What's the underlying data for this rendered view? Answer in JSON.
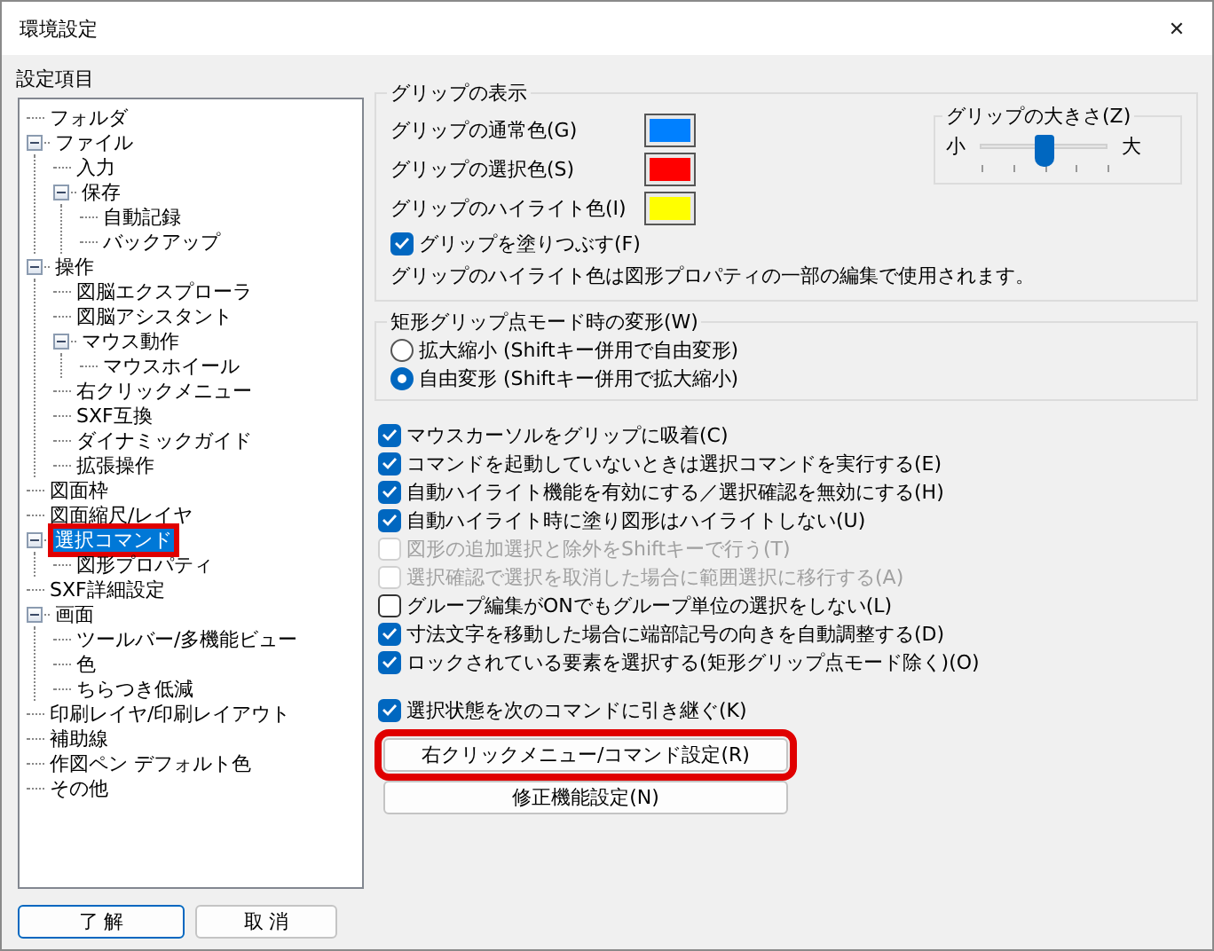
{
  "window": {
    "title": "環境設定",
    "close": "✕"
  },
  "sidebar": {
    "label": "設定項目",
    "tree": [
      {
        "label": "フォルダ",
        "selected": false,
        "highlighted": false
      },
      {
        "label": "ファイル",
        "selected": false,
        "highlighted": false,
        "expanded": true,
        "children": [
          {
            "label": "入力",
            "selected": false,
            "highlighted": false
          },
          {
            "label": "保存",
            "selected": false,
            "highlighted": false,
            "expanded": true,
            "children": [
              {
                "label": "自動記録",
                "selected": false,
                "highlighted": false
              },
              {
                "label": "バックアップ",
                "selected": false,
                "highlighted": false
              }
            ]
          }
        ]
      },
      {
        "label": "操作",
        "selected": false,
        "highlighted": false,
        "expanded": true,
        "children": [
          {
            "label": "図脳エクスプローラ",
            "selected": false,
            "highlighted": false
          },
          {
            "label": "図脳アシスタント",
            "selected": false,
            "highlighted": false
          },
          {
            "label": "マウス動作",
            "selected": false,
            "highlighted": false,
            "expanded": true,
            "children": [
              {
                "label": "マウスホイール",
                "selected": false,
                "highlighted": false
              }
            ]
          },
          {
            "label": "右クリックメニュー",
            "selected": false,
            "highlighted": false
          },
          {
            "label": "SXF互換",
            "selected": false,
            "highlighted": false
          },
          {
            "label": "ダイナミックガイド",
            "selected": false,
            "highlighted": false
          },
          {
            "label": "拡張操作",
            "selected": false,
            "highlighted": false
          }
        ]
      },
      {
        "label": "図面枠",
        "selected": false,
        "highlighted": false
      },
      {
        "label": "図面縮尺/レイヤ",
        "selected": false,
        "highlighted": false
      },
      {
        "label": "選択コマンド",
        "selected": true,
        "highlighted": true,
        "expanded": true,
        "children": [
          {
            "label": "図形プロパティ",
            "selected": false,
            "highlighted": false
          }
        ]
      },
      {
        "label": "SXF詳細設定",
        "selected": false,
        "highlighted": false
      },
      {
        "label": "画面",
        "selected": false,
        "highlighted": false,
        "expanded": true,
        "children": [
          {
            "label": "ツールバー/多機能ビュー",
            "selected": false,
            "highlighted": false
          },
          {
            "label": "色",
            "selected": false,
            "highlighted": false
          },
          {
            "label": "ちらつき低減",
            "selected": false,
            "highlighted": false
          }
        ]
      },
      {
        "label": "印刷レイヤ/印刷レイアウト",
        "selected": false,
        "highlighted": false
      },
      {
        "label": "補助線",
        "selected": false,
        "highlighted": false
      },
      {
        "label": "作図ペン デフォルト色",
        "selected": false,
        "highlighted": false
      },
      {
        "label": "その他",
        "selected": false,
        "highlighted": false
      }
    ]
  },
  "grip_display": {
    "title": "グリップの表示",
    "colors": [
      {
        "label": "グリップの通常色(G)",
        "color": "#0080ff"
      },
      {
        "label": "グリップの選択色(S)",
        "color": "#ff0000"
      },
      {
        "label": "グリップのハイライト色(I)",
        "color": "#ffff00"
      }
    ],
    "fill": {
      "label": "グリップを塗りつぶす(F)",
      "checked": true
    },
    "note": "グリップのハイライト色は図形プロパティの一部の編集で使用されます。",
    "size": {
      "title": "グリップの大きさ(Z)",
      "min_label": "小",
      "max_label": "大",
      "level": 0.5
    }
  },
  "deform": {
    "title": "矩形グリップ点モード時の変形(W)",
    "options": [
      {
        "label": "拡大縮小 (Shiftキー併用で自由変形)",
        "selected": false
      },
      {
        "label": "自由変形 (Shiftキー併用で拡大縮小)",
        "selected": true
      }
    ]
  },
  "options": [
    {
      "label": "マウスカーソルをグリップに吸着(C)",
      "checked": true,
      "disabled": false
    },
    {
      "label": "コマンドを起動していないときは選択コマンドを実行する(E)",
      "checked": true,
      "disabled": false
    },
    {
      "label": "自動ハイライト機能を有効にする／選択確認を無効にする(H)",
      "checked": true,
      "disabled": false
    },
    {
      "label": "自動ハイライト時に塗り図形はハイライトしない(U)",
      "checked": true,
      "disabled": false
    },
    {
      "label": "図形の追加選択と除外をShiftキーで行う(T)",
      "checked": false,
      "disabled": true
    },
    {
      "label": "選択確認で選択を取消した場合に範囲選択に移行する(A)",
      "checked": false,
      "disabled": true
    },
    {
      "label": "グループ編集がONでもグループ単位の選択をしない(L)",
      "checked": false,
      "disabled": false
    },
    {
      "label": "寸法文字を移動した場合に端部記号の向きを自動調整する(D)",
      "checked": true,
      "disabled": false
    },
    {
      "label": "ロックされている要素を選択する(矩形グリップ点モード除く)(O)",
      "checked": true,
      "disabled": false
    }
  ],
  "carry_over": {
    "label": "選択状態を次のコマンドに引き継ぐ(K)",
    "checked": true,
    "disabled": false
  },
  "action_buttons": [
    {
      "label": "右クリックメニュー/コマンド設定(R)",
      "highlighted": true
    },
    {
      "label": "修正機能設定(N)",
      "highlighted": false
    }
  ],
  "footer_buttons": [
    {
      "label": "了 解",
      "default": true
    },
    {
      "label": "取 消",
      "default": false
    }
  ]
}
